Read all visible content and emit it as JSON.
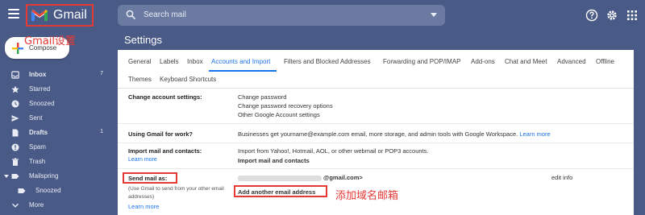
{
  "app": {
    "name": "Gmail"
  },
  "search": {
    "placeholder": "Search mail"
  },
  "annotations": {
    "gmail": "Gmail设置",
    "add_domain": "添加域名邮箱"
  },
  "compose": {
    "label": "Compose"
  },
  "sidebar": {
    "items": [
      {
        "label": "Inbox",
        "count": "7",
        "icon": "inbox-icon"
      },
      {
        "label": "Starred",
        "count": "",
        "icon": "star-icon"
      },
      {
        "label": "Snoozed",
        "count": "",
        "icon": "clock-icon"
      },
      {
        "label": "Sent",
        "count": "",
        "icon": "send-icon"
      },
      {
        "label": "Drafts",
        "count": "1",
        "icon": "draft-icon"
      },
      {
        "label": "Spam",
        "count": "",
        "icon": "spam-icon"
      },
      {
        "label": "Trash",
        "count": "",
        "icon": "trash-icon"
      },
      {
        "label": "Mailspring",
        "count": "",
        "icon": "label-icon"
      },
      {
        "label": "Snoozed",
        "count": "",
        "icon": "label-icon"
      },
      {
        "label": "More",
        "count": "",
        "icon": "chevron-down-icon"
      }
    ]
  },
  "main": {
    "title": "Settings",
    "tabs": [
      "General",
      "Labels",
      "Inbox",
      "Accounts and Import",
      "Filters and Blocked Addresses",
      "Forwarding and POP/IMAP",
      "Add-ons",
      "Chat and Meet",
      "Advanced",
      "Offline",
      "Themes",
      "Keyboard Shortcuts"
    ],
    "active_tab": "Accounts and Import",
    "sections": {
      "change_account": {
        "label": "Change account settings:",
        "links": [
          "Change password",
          "Change password recovery options",
          "Other Google Account settings"
        ]
      },
      "work": {
        "label": "Using Gmail for work?",
        "text": "Businesses get yourname@example.com email, more storage, and admin tools with Google Workspace.",
        "link": "Learn more"
      },
      "import": {
        "label": "Import mail and contacts:",
        "learn_more": "Learn more",
        "text": "Import from Yahoo!, Hotmail, AOL, or other webmail or POP3 accounts.",
        "link": "Import mail and contacts"
      },
      "send_as": {
        "label": "Send mail as:",
        "sub": "(Use Gmail to send from your other email addresses)",
        "learn_more": "Learn more",
        "address": "@gmail.com>",
        "edit": "edit info",
        "add_link": "Add another email address"
      }
    }
  },
  "colors": {
    "header_bg": "#4a5a86",
    "link": "#1a73e8",
    "annotation": "#e53935"
  }
}
